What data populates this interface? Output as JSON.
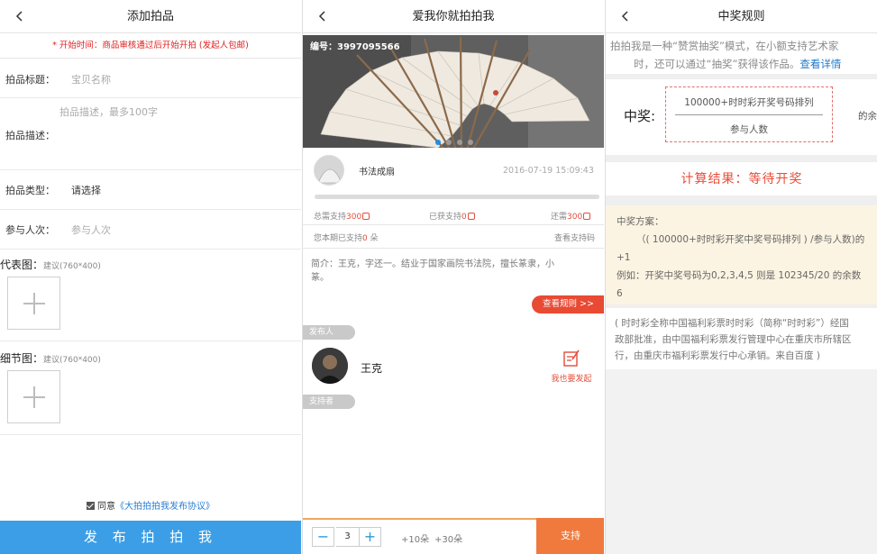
{
  "panel1": {
    "title": "添加拍品",
    "notice": "* 开始时间：商品审核通过后开始开拍 (发起人包邮)",
    "fields": {
      "title_label": "拍品标题：",
      "title_placeholder": "宝贝名称",
      "desc_label": "拍品描述：",
      "desc_placeholder": "拍品描述，最多100字",
      "type_label": "拍品类型：",
      "type_value": "请选择",
      "people_label": "参与人次：",
      "people_placeholder": "参与人次"
    },
    "cover": {
      "label": "代表图：",
      "hint": "建议(760*400)"
    },
    "detail": {
      "label": "细节图：",
      "hint": "建议(760*400)"
    },
    "agree_text": "同意",
    "agree_link": "《大拍拍拍我发布协议》",
    "submit": "发 布 拍 拍 我"
  },
  "panel2": {
    "title": "爱我你就拍拍我",
    "banner_id": "编号：3997095566",
    "seller_name": "书法成扇",
    "date": "2016-07-19  15:09:43",
    "stats": {
      "need_label": "总需支持",
      "need_value": "300",
      "got_label": "已获支持",
      "got_value": "0",
      "left_label": "还需",
      "left_value": "300",
      "mine_label": "您本期已支持",
      "mine_value": "0",
      "mine_unit": "朵",
      "code_link": "查看支持码"
    },
    "intro": "简介：王克，字还一。结业于国家画院书法院，擅长篆隶，小\n篆。",
    "rules_btn": "查看规则 >>",
    "publisher_tag": "发布人",
    "publisher_name": "王克",
    "launch_label": "我也要发起",
    "supporter_tag": "支持者",
    "stepper_minus": "−",
    "stepper_value": "3",
    "stepper_plus": "+",
    "quick1": "+10朵",
    "quick2": "+30朵",
    "support_btn": "支持"
  },
  "panel3": {
    "title": "中奖规则",
    "intro_line1": "拍拍我是一种“赞赏抽奖”模式，在小额支持艺术家",
    "intro_line2": "时，还可以通过“抽奖”获得该作品。",
    "intro_link": "查看详情",
    "win_label": "中奖:",
    "formula_top": "100000+时时彩开奖号码排列",
    "formula_bottom": "参与人数",
    "formula_rest": "的余",
    "result": "计算结果：等待开奖",
    "plan_title": "中奖方案：",
    "plan_line1": "（( 100000+时时彩开奖中奖号码排列 ) /参与人数)的",
    "plan_line2": "+1",
    "plan_line3": "例如：开奖中奖号码为0,2,3,4,5 则是 102345/20 的余数",
    "plan_line4": "6",
    "note_line1": "( 时时彩全称中国福利彩票时时彩（简称“时时彩”）经国",
    "note_line2": "政部批准，由中国福利彩票发行管理中心在重庆市所辖区",
    "note_line3": "行，由重庆市福利彩票发行中心承销。来自百度 )"
  },
  "colors": {
    "primary_blue": "#3c9ee6",
    "accent_red": "#e24d3b",
    "support_orange": "#f07a3e",
    "plan_bg": "#fcf4e2"
  }
}
